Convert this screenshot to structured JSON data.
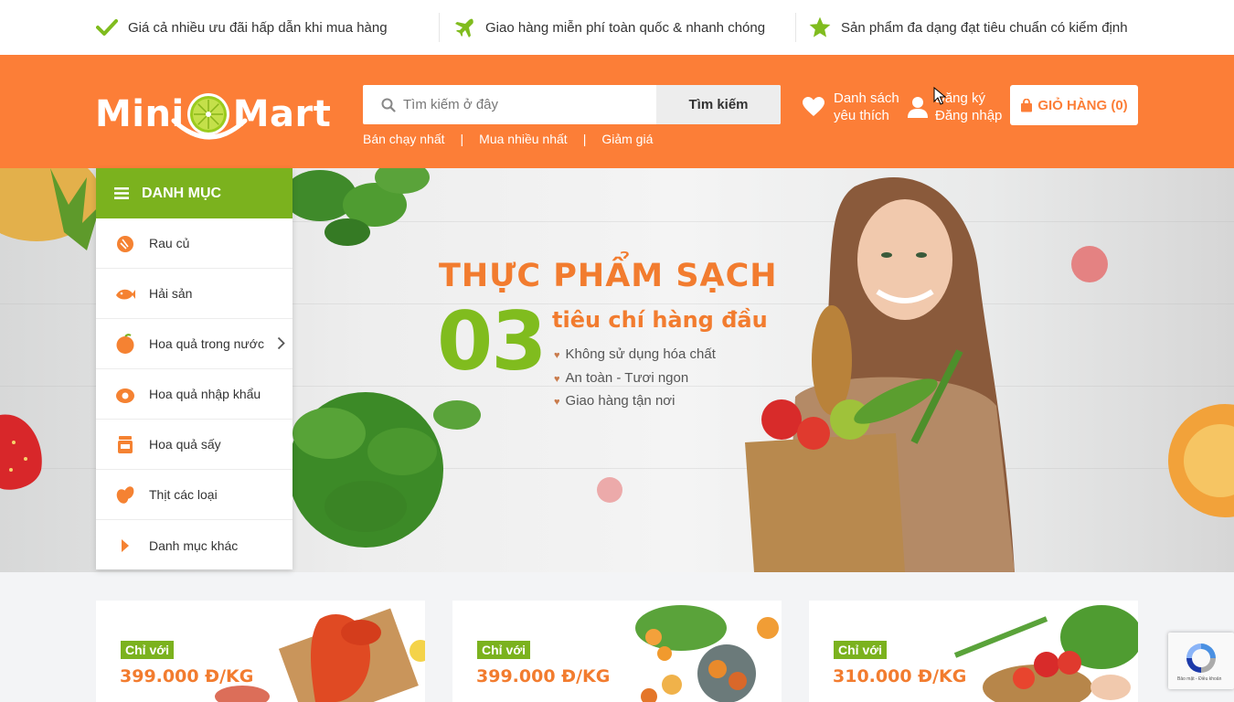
{
  "topbar": {
    "features": [
      {
        "icon": "check-icon",
        "text": "Giá cả nhiều ưu đãi hấp dẫn khi mua hàng"
      },
      {
        "icon": "airplane-icon",
        "text": "Giao hàng miễn phí toàn quốc & nhanh chóng"
      },
      {
        "icon": "star-icon",
        "text": "Sản phẩm đa dạng đạt tiêu chuẩn có kiểm định"
      }
    ]
  },
  "header": {
    "logo": {
      "part1": "Mini",
      "part2": "Mart"
    },
    "search": {
      "placeholder": "Tìm kiếm ở đây",
      "button_label": "Tìm kiếm"
    },
    "quick_links": [
      "Bán chạy nhất",
      "Mua nhiều nhất",
      "Giảm giá"
    ],
    "quick_sep": "|",
    "wishlist": {
      "line1": "Danh sách",
      "line2": "yêu thích"
    },
    "account": {
      "line1": "Đăng ký",
      "line2": "Đăng nhập"
    },
    "cart": {
      "label": "GIỎ HÀNG (0)"
    }
  },
  "menu": {
    "title": "DANH MỤC",
    "items": [
      {
        "label": "Rau củ",
        "icon": "vegetable-icon",
        "has_sub": false
      },
      {
        "label": "Hải sản",
        "icon": "fish-icon",
        "has_sub": false
      },
      {
        "label": "Hoa quả trong nước",
        "icon": "orange-icon",
        "has_sub": true
      },
      {
        "label": "Hoa quả nhập khẩu",
        "icon": "fruit-icon",
        "has_sub": false
      },
      {
        "label": "Hoa quả sấy",
        "icon": "jar-icon",
        "has_sub": false
      },
      {
        "label": "Thịt các loại",
        "icon": "meat-icon",
        "has_sub": false
      },
      {
        "label": "Danh mục khác",
        "icon": "caret-right-icon",
        "has_sub": false
      }
    ]
  },
  "banner": {
    "title": "THỰC PHẨM SẠCH",
    "number": "03",
    "subtitle": "tiêu chí hàng đầu",
    "points": [
      "Không sử dụng hóa chất",
      "An toàn - Tươi ngon",
      "Giao hàng tận nơi"
    ]
  },
  "promos": [
    {
      "tag": "Chỉ với",
      "price": "399.000 Đ/KG",
      "image": "lobster"
    },
    {
      "tag": "Chỉ với",
      "price": "399.000 Đ/KG",
      "image": "fruits"
    },
    {
      "tag": "Chỉ với",
      "price": "310.000 Đ/KG",
      "image": "vegetables"
    }
  ],
  "recaptcha": {
    "text": "Bảo mật - Điều khoản"
  },
  "colors": {
    "orange": "#fc7e37",
    "green": "#7bb21e",
    "text": "#333333"
  }
}
